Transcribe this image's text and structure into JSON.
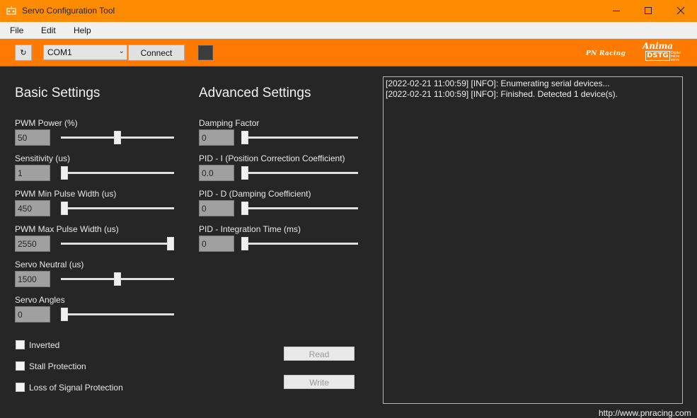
{
  "window": {
    "title": "Servo Configuration Tool",
    "accent_color": "#ff8c00"
  },
  "menu": [
    "File",
    "Edit",
    "Help"
  ],
  "toolbar": {
    "refresh_label": "↻",
    "port_value": "COM1",
    "connect_label": "Connect",
    "status_led_color": "#3c3c3c",
    "logo_pn": "PN Racing",
    "logo_anima": "Anima",
    "logo_anima_badge": "DSTG",
    "logo_anima_small": "Digital micro servo"
  },
  "basic": {
    "title": "Basic Settings",
    "fields": [
      {
        "label": "PWM Power (%)",
        "value": "50",
        "slider_fraction": 0.5
      },
      {
        "label": "Sensitivity (us)",
        "value": "1",
        "slider_fraction": 0.0
      },
      {
        "label": "PWM Min Pulse Width (us)",
        "value": "450",
        "slider_fraction": 0.0
      },
      {
        "label": "PWM Max Pulse Width (us)",
        "value": "2550",
        "slider_fraction": 1.0
      },
      {
        "label": "Servo Neutral (us)",
        "value": "1500",
        "slider_fraction": 0.5
      },
      {
        "label": "Servo Angles",
        "value": "0",
        "slider_fraction": 0.0
      }
    ],
    "checkboxes": [
      {
        "label": "Inverted",
        "checked": false
      },
      {
        "label": "Stall Protection",
        "checked": false
      },
      {
        "label": "Loss of Signal Protection",
        "checked": false
      }
    ]
  },
  "advanced": {
    "title": "Advanced Settings",
    "fields": [
      {
        "label": "Damping Factor",
        "value": "0",
        "slider_fraction": 0.0
      },
      {
        "label": "PID - I (Position Correction Coefficient)",
        "value": "0.0",
        "slider_fraction": 0.0
      },
      {
        "label": "PID - D (Damping Coefficient)",
        "value": "0",
        "slider_fraction": 0.0
      },
      {
        "label": "PID - Integration Time (ms)",
        "value": "0",
        "slider_fraction": 0.0
      }
    ],
    "read_label": "Read",
    "write_label": "Write"
  },
  "log": [
    "[2022-02-21 11:00:59] [INFO]: Enumerating serial devices...",
    "[2022-02-21 11:00:59] [INFO]: Finished. Detected 1 device(s)."
  ],
  "footer": {
    "link": "http://www.pnracing.com"
  }
}
